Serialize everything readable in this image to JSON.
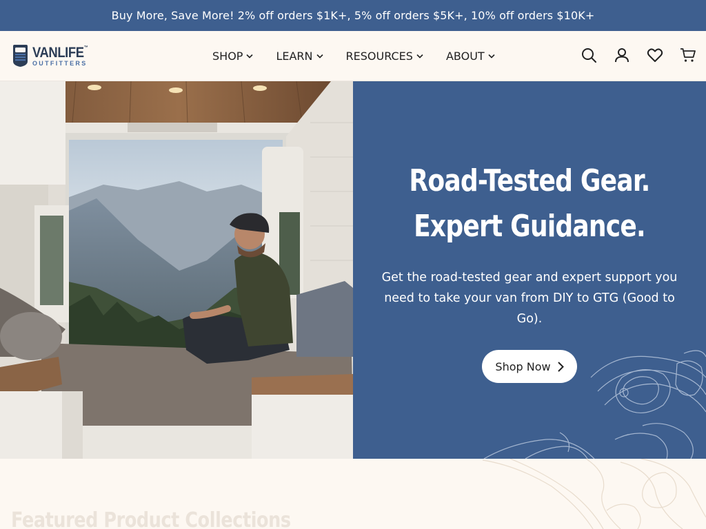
{
  "promo": {
    "text": "Buy More, Save More! 2% off orders $1K+, 5% off orders $5K+, 10% off orders $10K+"
  },
  "header": {
    "logo": {
      "main": "VANLIFE",
      "trademark": "™",
      "sub": "OUTFITTERS"
    },
    "nav": [
      {
        "label": "SHOP"
      },
      {
        "label": "LEARN"
      },
      {
        "label": "RESOURCES"
      },
      {
        "label": "ABOUT"
      }
    ],
    "icons": [
      "search-icon",
      "account-icon",
      "wishlist-heart-icon",
      "cart-icon"
    ]
  },
  "hero": {
    "title_line1": "Road-Tested Gear.",
    "title_line2": "Expert Guidance.",
    "subtitle": "Get the road-tested gear and expert support you need to take your van from DIY to GTG (Good to Go).",
    "cta_label": "Shop Now"
  },
  "collections": {
    "heading": "Featured Product Collections"
  },
  "colors": {
    "brand_blue": "#3e5f8f",
    "background": "#fdf8f2",
    "text_dark": "#222222"
  }
}
